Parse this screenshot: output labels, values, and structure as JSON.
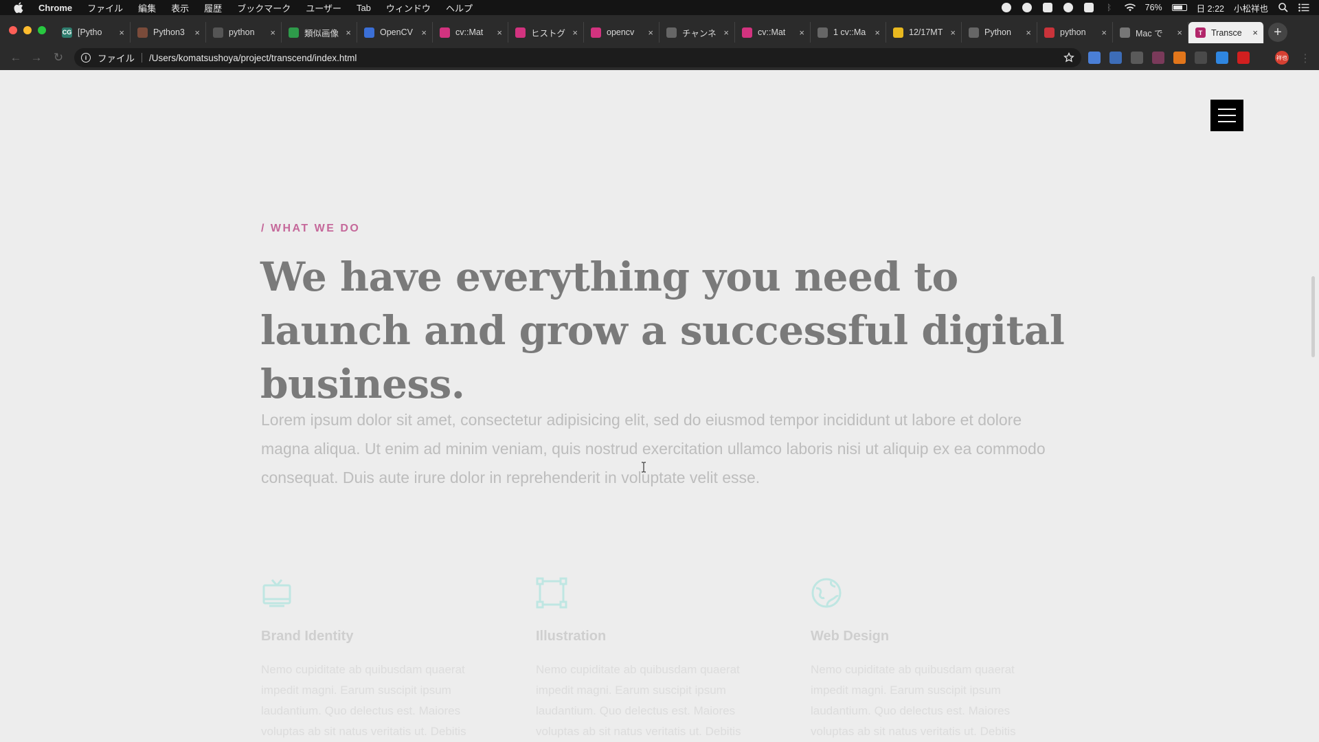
{
  "menubar": {
    "app_name": "Chrome",
    "items": [
      "ファイル",
      "編集",
      "表示",
      "履歴",
      "ブックマーク",
      "ユーザー",
      "Tab",
      "ウィンドウ",
      "ヘルプ"
    ],
    "battery_percent": "76%",
    "battery_level": 0.76,
    "clock": "日 2:22",
    "user": "小松祥也"
  },
  "tabs": [
    {
      "title": "[Pytho",
      "favicon_text": "CG",
      "favicon_color": "#2f7d6e"
    },
    {
      "title": "Python3",
      "favicon_text": "",
      "favicon_color": "#7a4b3a"
    },
    {
      "title": "python",
      "favicon_text": "",
      "favicon_color": "#555555"
    },
    {
      "title": "類似画像",
      "favicon_text": "",
      "favicon_color": "#2e9a4a"
    },
    {
      "title": "OpenCV",
      "favicon_text": "",
      "favicon_color": "#3b6fd6"
    },
    {
      "title": "cv::Mat",
      "favicon_text": "",
      "favicon_color": "#d2337f"
    },
    {
      "title": "ヒストグ",
      "favicon_text": "",
      "favicon_color": "#d2337f"
    },
    {
      "title": "opencv",
      "favicon_text": "",
      "favicon_color": "#d2337f"
    },
    {
      "title": "チャンネ",
      "favicon_text": "",
      "favicon_color": "#666666"
    },
    {
      "title": "cv::Mat",
      "favicon_text": "",
      "favicon_color": "#d2337f"
    },
    {
      "title": "1 cv::Ma",
      "favicon_text": "",
      "favicon_color": "#666666"
    },
    {
      "title": "12/17MT",
      "favicon_text": "",
      "favicon_color": "#e8b81f"
    },
    {
      "title": "Python",
      "favicon_text": "",
      "favicon_color": "#666666"
    },
    {
      "title": "python",
      "favicon_text": "",
      "favicon_color": "#c9333a"
    },
    {
      "title": "Mac で",
      "favicon_text": "",
      "favicon_color": "#777777"
    },
    {
      "title": "Transce",
      "favicon_text": "T",
      "favicon_color": "#b2266a"
    }
  ],
  "active_tab_index": 15,
  "address_bar": {
    "scheme_label": "ファイル",
    "url": "/Users/komatsushoya/project/transcend/index.html"
  },
  "extensions": [
    {
      "name": "translate-icon",
      "color": "#4a7fd6"
    },
    {
      "name": "dictionary-icon",
      "color": "#3d6db8"
    },
    {
      "name": "screen-icon",
      "color": "#5a5a5a"
    },
    {
      "name": "calendar-icon",
      "color": "#7a3a5a"
    },
    {
      "name": "metamask-icon",
      "color": "#e2761b"
    },
    {
      "name": "se-icon",
      "color": "#4a4a4a"
    },
    {
      "name": "globe-ext-icon",
      "color": "#2f86e0"
    },
    {
      "name": "youtube-icon",
      "color": "#d11f1f"
    }
  ],
  "profile_initials": "祥也",
  "hero": {
    "eyebrow": "/ WHAT WE DO",
    "headline": "We have everything you need to launch and grow a successful digital business.",
    "lead": "Lorem ipsum dolor sit amet, consectetur adipisicing elit, sed do eiusmod tempor incididunt ut labore et dolore magna aliqua. Ut enim ad minim veniam, quis nostrud exercitation ullamco laboris nisi ut aliquip ex ea commodo consequat. Duis aute irure dolor in reprehenderit in voluptate velit esse."
  },
  "services": [
    {
      "title": "Brand Identity",
      "icon": "tv-icon",
      "text": "Nemo cupiditate ab quibusdam quaerat impedit magni. Earum suscipit ipsum laudantium. Quo delectus est. Maiores voluptas ab sit natus veritatis ut. Debitis"
    },
    {
      "title": "Illustration",
      "icon": "vector-frame-icon",
      "text": "Nemo cupiditate ab quibusdam quaerat impedit magni. Earum suscipit ipsum laudantium. Quo delectus est. Maiores voluptas ab sit natus veritatis ut. Debitis"
    },
    {
      "title": "Web Design",
      "icon": "globe-icon",
      "text": "Nemo cupiditate ab quibusdam quaerat impedit magni. Earum suscipit ipsum laudantium. Quo delectus est. Maiores voluptas ab sit natus veritatis ut. Debitis"
    }
  ],
  "colors": {
    "accent": "#c5689a",
    "icon_teal": "#bfe6e2",
    "headline": "#7a7a7a"
  }
}
